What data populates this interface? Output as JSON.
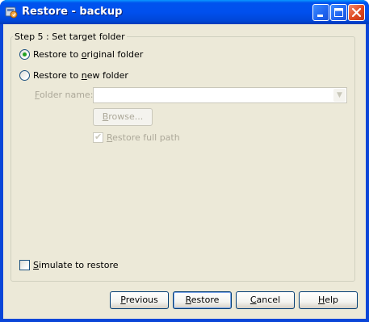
{
  "window": {
    "title": "Restore - backup",
    "app_icon": "backup-app-icon",
    "caption_buttons": [
      "minimize-icon",
      "maximize-icon",
      "close-icon"
    ]
  },
  "step": {
    "group_title": "Step 5 : Set target folder",
    "radio_original": {
      "label_pre": "Restore to ",
      "label_accel": "o",
      "label_post": "riginal folder",
      "selected": true
    },
    "radio_new": {
      "label_pre": "Restore to ",
      "label_accel": "n",
      "label_post": "ew folder",
      "selected": false
    },
    "folder_name": {
      "label_accel": "F",
      "label_post": "older name:",
      "value": ""
    },
    "browse_button": {
      "label_accel": "B",
      "label_post": "rowse..."
    },
    "restore_full_path": {
      "label_pre": "",
      "label_accel": "R",
      "label_post": "estore full path",
      "checked": true
    }
  },
  "simulate": {
    "label_accel": "S",
    "label_post": "imulate to restore",
    "checked": false
  },
  "footer": {
    "previous": {
      "accel": "P",
      "post": "revious"
    },
    "restore": {
      "accel": "R",
      "post": "estore"
    },
    "cancel": {
      "accel": "C",
      "post": "ancel"
    },
    "help": {
      "accel": "H",
      "post": "elp"
    }
  },
  "colors": {
    "titlebar": "#0053ee",
    "dialog_face": "#ece9d8",
    "radio_dot": "#21a121",
    "close_button": "#e0481e",
    "disabled_text": "#aca899"
  }
}
